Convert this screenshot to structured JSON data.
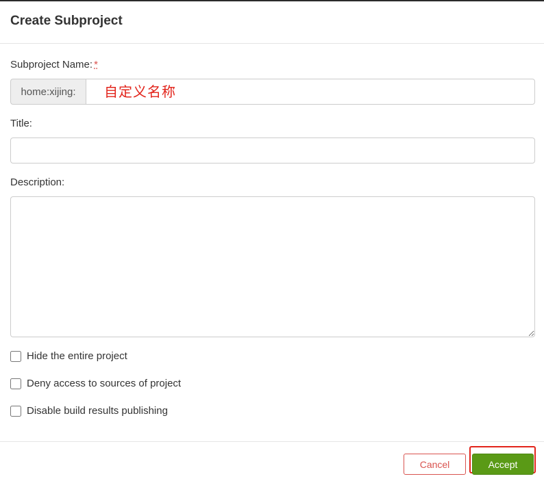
{
  "dialog": {
    "title": "Create Subproject"
  },
  "form": {
    "name_label": "Subproject Name:",
    "required_mark": "*",
    "name_prefix": "home:xijing:",
    "name_value": "",
    "name_annotation": "自定义名称",
    "title_label": "Title:",
    "title_value": "",
    "description_label": "Description:",
    "description_value": "",
    "checkboxes": [
      {
        "label": "Hide the entire project",
        "checked": false
      },
      {
        "label": "Deny access to sources of project",
        "checked": false
      },
      {
        "label": "Disable build results publishing",
        "checked": false
      }
    ]
  },
  "footer": {
    "cancel_label": "Cancel",
    "accept_label": "Accept"
  },
  "colors": {
    "accept_bg": "#5a9a16",
    "cancel_border": "#d9534f",
    "annotation": "#e2231a"
  }
}
